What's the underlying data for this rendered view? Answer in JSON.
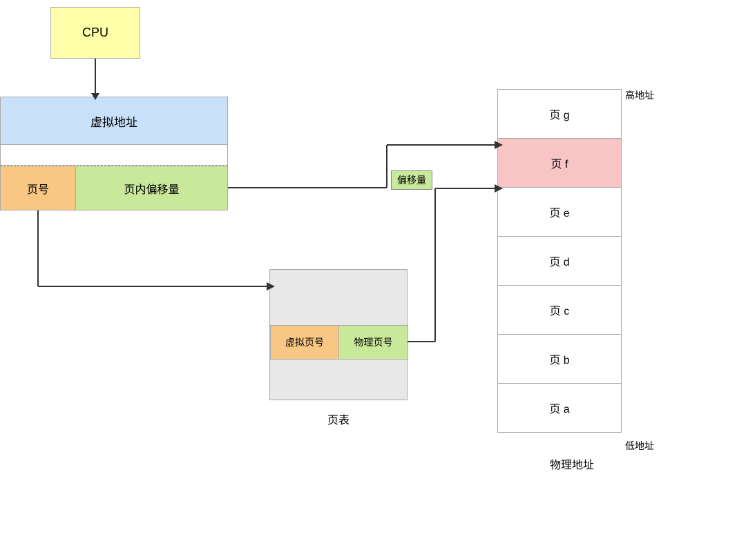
{
  "cpu": {
    "label": "CPU"
  },
  "virtual_address": {
    "label": "虚拟地址"
  },
  "page_number": {
    "label": "页号"
  },
  "page_offset": {
    "label": "页内偏移量"
  },
  "page_table": {
    "label": "页表",
    "vp_label": "虚拟页号",
    "pp_label": "物理页号"
  },
  "offset_badge": {
    "label": "偏移量"
  },
  "physical_memory": {
    "label": "物理地址",
    "high_label": "高地址",
    "low_label": "低地址",
    "pages": [
      {
        "label": "页 g",
        "highlighted": false
      },
      {
        "label": "页 f",
        "highlighted": true
      },
      {
        "label": "页 e",
        "highlighted": false
      },
      {
        "label": "页 d",
        "highlighted": false
      },
      {
        "label": "页 c",
        "highlighted": false
      },
      {
        "label": "页 b",
        "highlighted": false
      },
      {
        "label": "页 a",
        "highlighted": false
      }
    ]
  }
}
